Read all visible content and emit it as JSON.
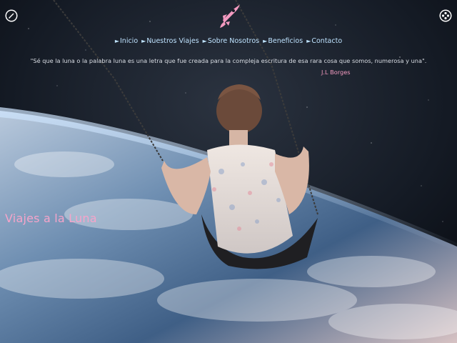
{
  "nav": {
    "items": [
      {
        "label": "Inicio"
      },
      {
        "label": "Nuestros Viajes"
      },
      {
        "label": "Sobre Nosotros"
      },
      {
        "label": "Beneficios"
      },
      {
        "label": "Contacto"
      }
    ],
    "arrow": "►"
  },
  "quote": {
    "text": "\"Sé que la luna o la palabra luna es una letra que fue creada para la compleja escritura de esa rara cosa que somos, numerosa y una\".",
    "author": "J.L Borges"
  },
  "title": "Viajes a la Luna",
  "icons": {
    "logo": "rocket-icon",
    "left": "moon-rocket-icon",
    "right": "menu-icon"
  },
  "colors": {
    "accent_pink": "#f39ac0",
    "nav_text": "#bfe3ff",
    "quote_text": "#d9dde4",
    "title": "#f6a4ca"
  }
}
